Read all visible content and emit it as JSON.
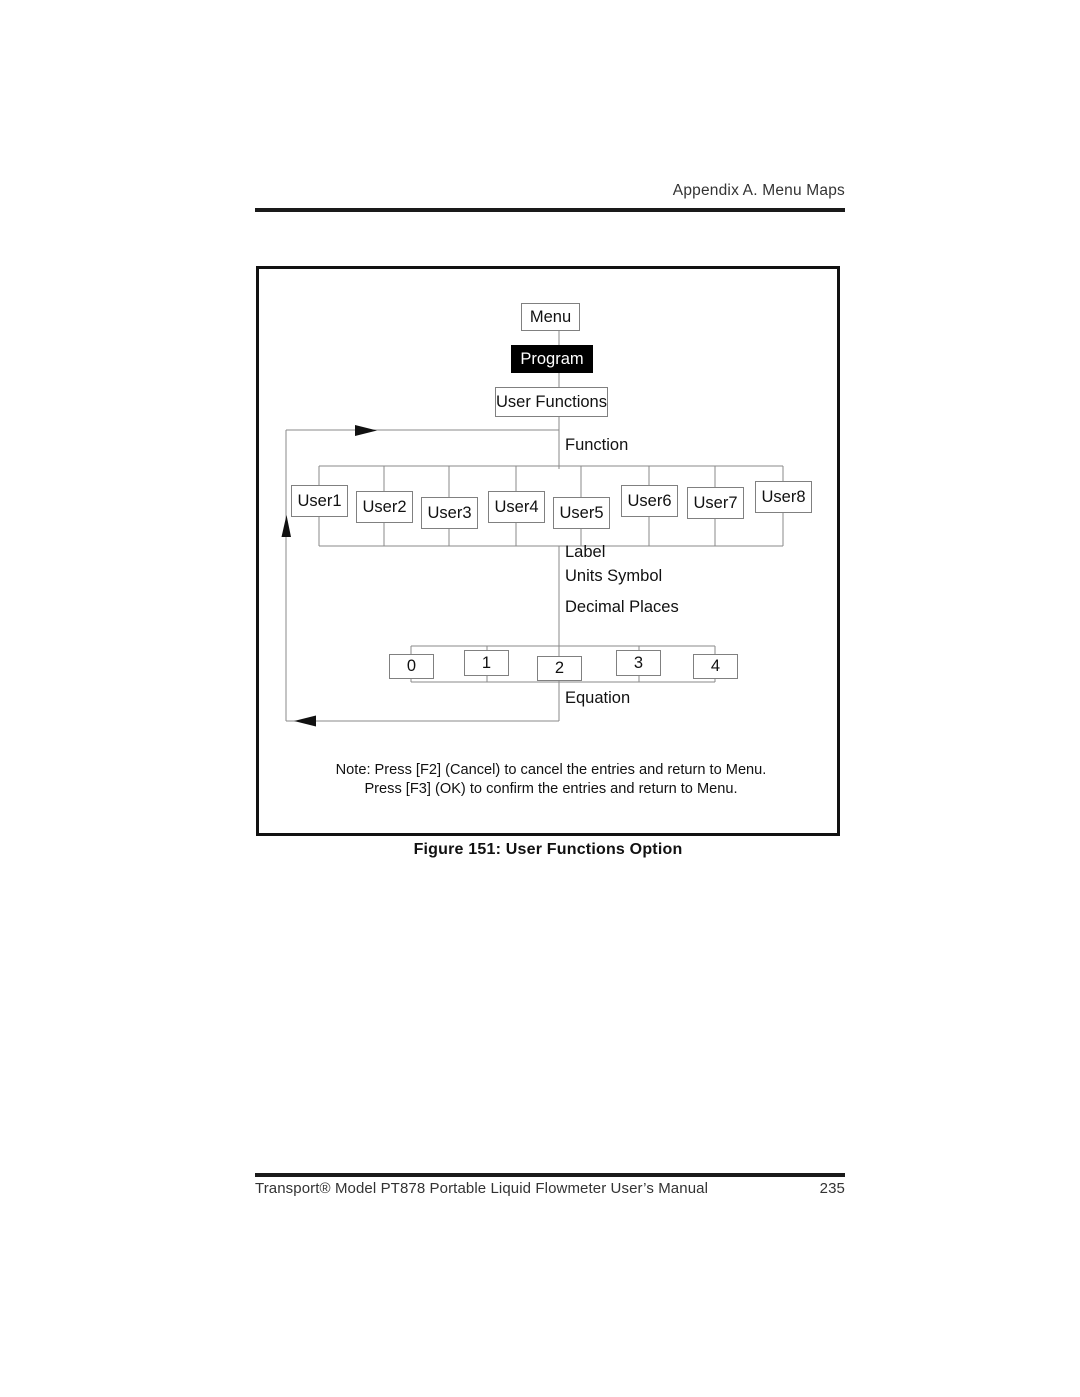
{
  "header": {
    "running_head": "Appendix A. Menu Maps"
  },
  "figure": {
    "caption": "Figure 151: User Functions Option",
    "note_line1": "Note: Press [F2] (Cancel) to cancel the entries and return to Menu.",
    "note_line2": "Press [F3] (OK) to confirm the entries and return to Menu."
  },
  "diagram": {
    "type": "menu-map-tree",
    "root": "Menu",
    "nodes": {
      "menu": "Menu",
      "program": "Program",
      "user_functions": "User Functions"
    },
    "branch_labels": {
      "function": "Function",
      "label": "Label",
      "units_symbol": "Units Symbol",
      "decimal_places": "Decimal Places",
      "equation": "Equation"
    },
    "user_options": [
      "User1",
      "User2",
      "User3",
      "User4",
      "User5",
      "User6",
      "User7",
      "User8"
    ],
    "decimal_place_options": [
      "0",
      "1",
      "2",
      "3",
      "4"
    ],
    "highlighted_node": "Program",
    "colors": {
      "highlight_bg": "#000000",
      "highlight_fg": "#ffffff",
      "node_border": "#808080",
      "frame_border": "#111111",
      "line": "#808080"
    }
  },
  "footer": {
    "manual_title": "Transport® Model PT878 Portable Liquid Flowmeter User’s Manual",
    "page_number": "235"
  }
}
